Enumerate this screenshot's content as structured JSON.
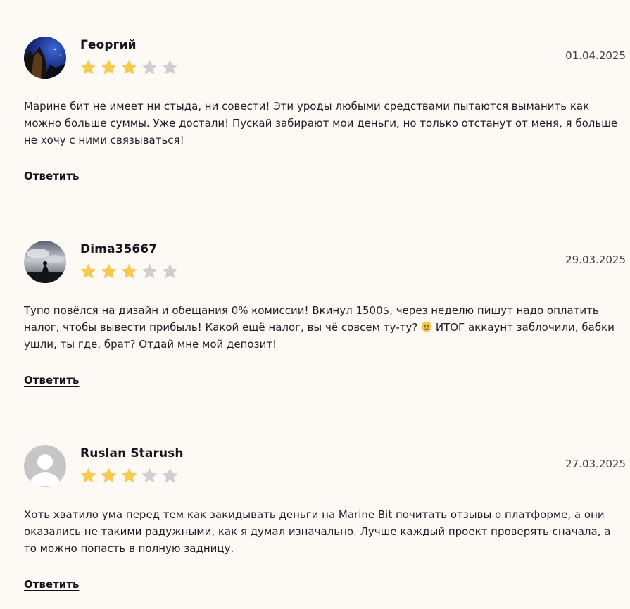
{
  "colors": {
    "background": "#fdfaf6",
    "star_filled": "#f6c94f",
    "star_empty": "#cfcfd1"
  },
  "reviews": [
    {
      "author": "Георгий",
      "date": "01.04.2025",
      "rating": 3,
      "rating_max": 5,
      "avatar": "night-photo-avatar",
      "text": "Марине бит не имеет ни стыда, ни совести! Эти уроды любыми средствами пытаются выманить как можно больше суммы. Уже достали! Пускай забирают мои деньги, но только отстанут от меня, я больше не хочу с ними связываться!",
      "reply_label": "Ответить"
    },
    {
      "author": "Dima35667",
      "date": "29.03.2025",
      "rating": 3,
      "rating_max": 5,
      "avatar": "silhouette-sky-avatar",
      "text_before_emoji": "Тупо повёлся на дизайн и обещания 0% комиссии! Вкинул 1500$, через неделю пишут надо оплатить налог, чтобы вывести прибыль! Какой ещё налог, вы чё совсем ту-ту? ",
      "emoji": "angry-face-emoji",
      "text_after_emoji": " ИТОГ аккаунт заблочили, бабки ушли, ты где, брат? Отдай мне мой депозит!",
      "reply_label": "Ответить"
    },
    {
      "author": "Ruslan Starush",
      "date": "27.03.2025",
      "rating": 3,
      "rating_max": 5,
      "avatar": "default-user-avatar",
      "text": "Хоть хватило ума перед тем как закидывать деньги на Marine Bit почитать отзывы о платформе, а они оказались не такими радужными, как я думал изначально. Лучше каждый проект проверять сначала, а то можно попасть в полную задницу.",
      "reply_label": "Ответить"
    }
  ]
}
